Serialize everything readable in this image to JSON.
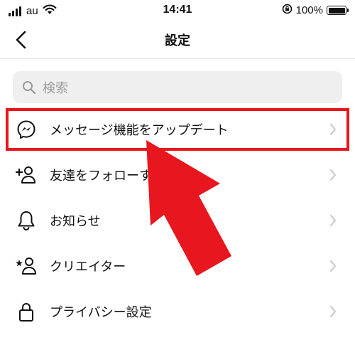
{
  "status_bar": {
    "carrier": "au",
    "time": "14:41",
    "battery": "100%"
  },
  "nav": {
    "title": "設定"
  },
  "search": {
    "placeholder": "検索"
  },
  "menu": {
    "items": [
      {
        "label": "メッセージ機能をアップデート",
        "icon": "messenger-icon"
      },
      {
        "label": "友達をフォローする",
        "icon": "add-person-icon"
      },
      {
        "label": "お知らせ",
        "icon": "bell-icon"
      },
      {
        "label": "クリエイター",
        "icon": "star-person-icon"
      },
      {
        "label": "プライバシー設定",
        "icon": "lock-icon"
      }
    ]
  },
  "colors": {
    "highlight": "#e8161e",
    "arrow": "#e8161e",
    "chevron": "#c7c7cc"
  }
}
